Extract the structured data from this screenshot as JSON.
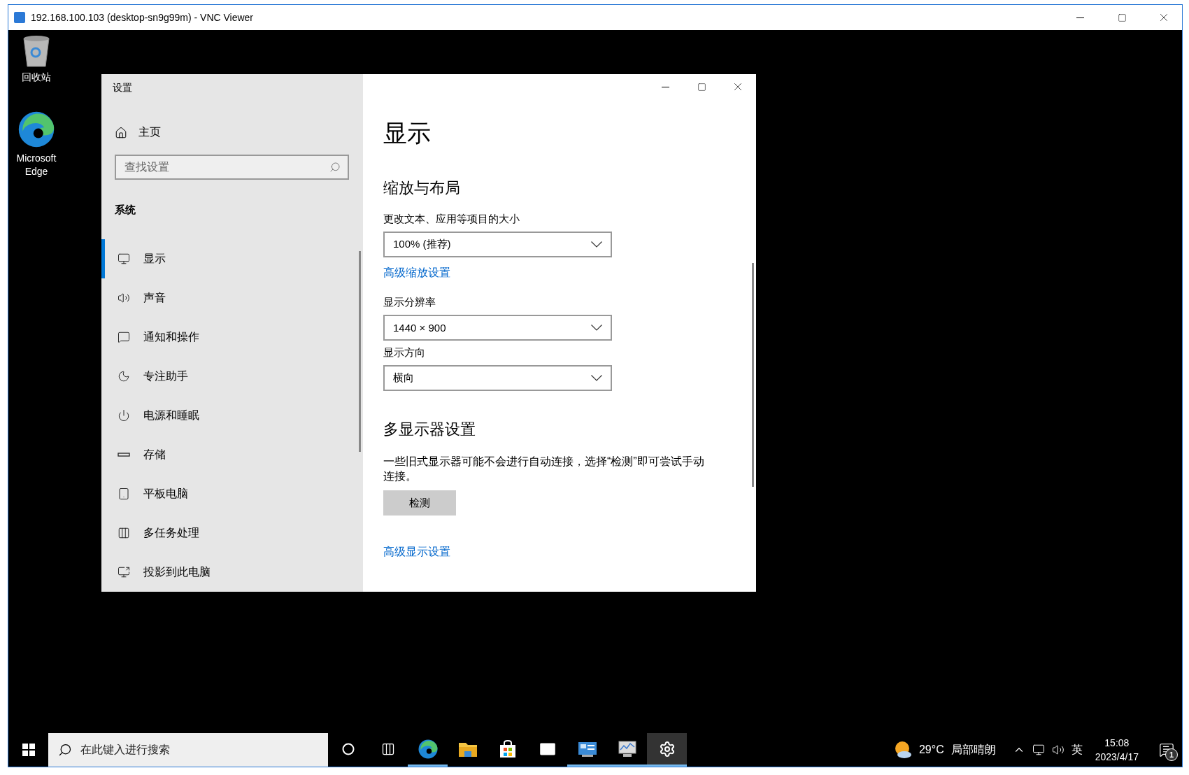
{
  "viewer": {
    "title": "192.168.100.103 (desktop-sn9g99m) - VNC Viewer"
  },
  "desktop_icons": [
    {
      "kind": "recycle-bin",
      "label": "回收站"
    },
    {
      "kind": "edge",
      "label": "Microsoft Edge"
    }
  ],
  "settings": {
    "title": "设置",
    "home": "主页",
    "search": {
      "placeholder": "查找设置"
    },
    "section": "系统",
    "nav": [
      {
        "kind": "display",
        "label": "显示",
        "selected": true
      },
      {
        "kind": "sound",
        "label": "声音",
        "selected": false
      },
      {
        "kind": "notify",
        "label": "通知和操作",
        "selected": false
      },
      {
        "kind": "focus",
        "label": "专注助手",
        "selected": false
      },
      {
        "kind": "power",
        "label": "电源和睡眠",
        "selected": false
      },
      {
        "kind": "storage",
        "label": "存储",
        "selected": false
      },
      {
        "kind": "tablet",
        "label": "平板电脑",
        "selected": false
      },
      {
        "kind": "multitask",
        "label": "多任务处理",
        "selected": false
      },
      {
        "kind": "project",
        "label": "投影到此电脑",
        "selected": false
      }
    ],
    "page_title": "显示",
    "content": [
      {
        "kind": "heading",
        "text": "缩放与布局"
      },
      {
        "kind": "label",
        "text": "更改文本、应用等项目的大小"
      },
      {
        "kind": "dropdown",
        "text": "100% (推荐)"
      },
      {
        "kind": "link",
        "text": "高级缩放设置"
      },
      {
        "kind": "label",
        "text": "显示分辨率"
      },
      {
        "kind": "dropdown",
        "text": "1440 × 900"
      },
      {
        "kind": "label",
        "text": "显示方向"
      },
      {
        "kind": "dropdown",
        "text": "横向"
      },
      {
        "kind": "heading",
        "text": "多显示器设置"
      },
      {
        "kind": "paragraph",
        "text": "一些旧式显示器可能不会进行自动连接，选择“检测”即可尝试手动连接。"
      },
      {
        "kind": "button",
        "text": "检测"
      },
      {
        "kind": "link",
        "text": "高级显示设置"
      }
    ]
  },
  "taskbar": {
    "search": {
      "placeholder": "在此键入进行搜索"
    },
    "apps": [
      {
        "kind": "cortana",
        "running": false,
        "selected": false
      },
      {
        "kind": "taskview",
        "running": false,
        "selected": false
      },
      {
        "kind": "edge",
        "running": true,
        "selected": false
      },
      {
        "kind": "folder",
        "running": false,
        "selected": false
      },
      {
        "kind": "store",
        "running": false,
        "selected": false
      },
      {
        "kind": "mail",
        "running": false,
        "selected": false
      },
      {
        "kind": "control",
        "running": true,
        "selected": false
      },
      {
        "kind": "monitor",
        "running": true,
        "selected": false
      },
      {
        "kind": "settings",
        "running": true,
        "selected": true
      }
    ],
    "weather": {
      "temp": "29°C",
      "condition": "局部晴朗"
    },
    "ime": "英",
    "time": "15:08",
    "date": "2023/4/17",
    "notifications": "1"
  }
}
